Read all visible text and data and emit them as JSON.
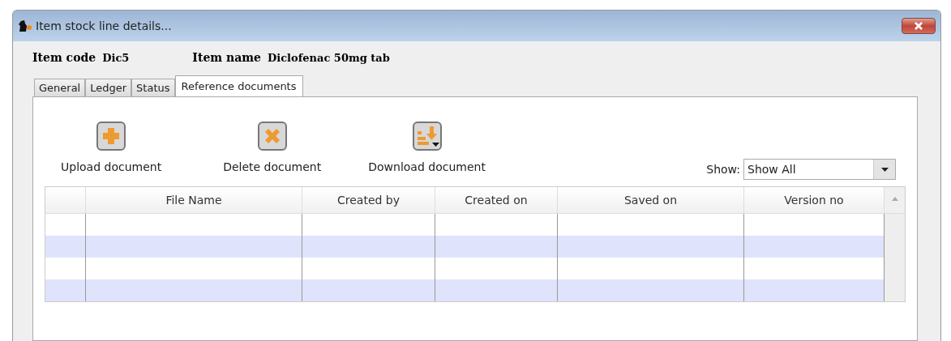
{
  "window": {
    "title": "Item stock line details..."
  },
  "item": {
    "code_label": "Item code",
    "code": "Dic5",
    "name_label": "Item name",
    "name": "Diclofenac 50mg tab"
  },
  "tabs": [
    {
      "label": "General",
      "selected": false
    },
    {
      "label": "Ledger",
      "selected": false
    },
    {
      "label": "Status",
      "selected": false
    },
    {
      "label": "Reference documents",
      "selected": true
    }
  ],
  "actions": [
    {
      "kind": "upload",
      "label": "Upload document"
    },
    {
      "kind": "delete",
      "label": "Delete document"
    },
    {
      "kind": "download",
      "label": "Download document"
    }
  ],
  "show": {
    "label": "Show:",
    "value": "Show All"
  },
  "table": {
    "columns": [
      "",
      "File Name",
      "Created by",
      "Created on",
      "Saved on",
      "Version no"
    ]
  }
}
